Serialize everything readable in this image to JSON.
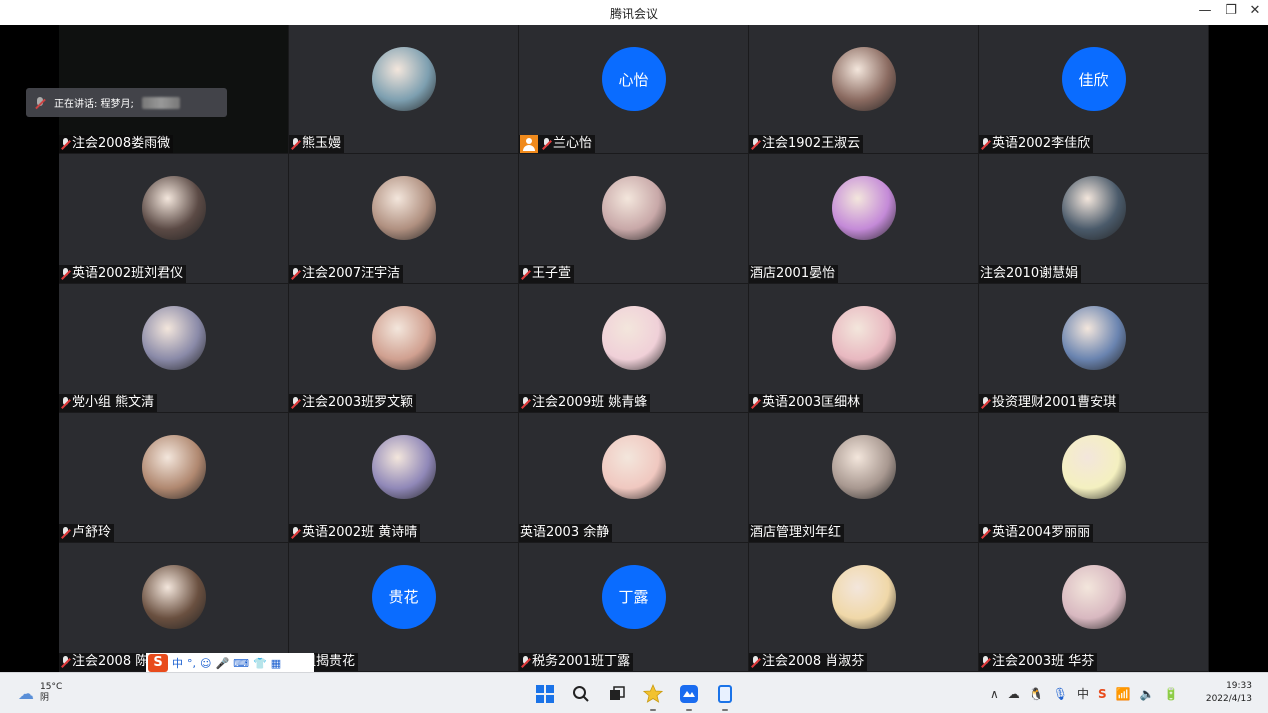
{
  "window": {
    "title": "腾讯会议",
    "controls": {
      "minimize": "—",
      "restore": "❐",
      "close": "✕"
    }
  },
  "speaking": {
    "label": "正在讲话: 程梦月;"
  },
  "participants": [
    {
      "name": "注会2008娄雨微",
      "muted": true,
      "video": true
    },
    {
      "name": "熊玉嫚",
      "muted": true,
      "avatar": "photo-avatar",
      "color": "#7d9fb0"
    },
    {
      "name": "兰心怡",
      "muted": true,
      "host": true,
      "avatar_text": "心怡"
    },
    {
      "name": "注会1902王淑云",
      "muted": true,
      "avatar": "photo-avatar",
      "color": "#8a6a60"
    },
    {
      "name": "英语2002李佳欣",
      "muted": true,
      "avatar_text": "佳欣"
    },
    {
      "name": "英语2002班刘君仪",
      "muted": true,
      "avatar": "photo-avatar",
      "color": "#5b4a45"
    },
    {
      "name": "注会2007汪宇洁",
      "muted": true,
      "avatar": "photo-avatar",
      "color": "#b09080"
    },
    {
      "name": "王子萱",
      "muted": true,
      "avatar": "photo-avatar",
      "color": "#c8a8a8"
    },
    {
      "name": "酒店2001晏怡",
      "muted": false,
      "avatar": "cartoon-avatar",
      "color": "#c48ad8"
    },
    {
      "name": "注会2010谢慧娟",
      "muted": false,
      "avatar": "photo-avatar",
      "color": "#4a5a6a"
    },
    {
      "name": "党小组 熊文清",
      "muted": true,
      "avatar": "photo-avatar",
      "color": "#8a8aa8"
    },
    {
      "name": "注会2003班罗文颖",
      "muted": true,
      "avatar": "photo-avatar",
      "color": "#d0a090"
    },
    {
      "name": "注会2009班 姚青蜂",
      "muted": true,
      "avatar": "cartoon-avatar",
      "color": "#f0d0d8"
    },
    {
      "name": "英语2003匡细林",
      "muted": true,
      "avatar": "cartoon-avatar",
      "color": "#e8b8c0"
    },
    {
      "name": "投资理财2001曹安琪",
      "muted": true,
      "avatar": "cartoon-avatar",
      "color": "#6a84b0"
    },
    {
      "name": "卢舒玲",
      "muted": true,
      "avatar": "photo-avatar",
      "color": "#b08870"
    },
    {
      "name": "英语2002班 黄诗晴",
      "muted": true,
      "avatar": "photo-avatar",
      "color": "#9088b8"
    },
    {
      "name": "英语2003 余静",
      "muted": false,
      "avatar": "cartoon-avatar",
      "color": "#f0c8c0"
    },
    {
      "name": "酒店管理刘年红",
      "muted": false,
      "avatar": "photo-avatar",
      "color": "#a89890"
    },
    {
      "name": "英语2004罗丽丽",
      "muted": true,
      "avatar": "cartoon-avatar",
      "color": "#f4f0c0"
    },
    {
      "name": "注会2008 陈",
      "muted": true,
      "avatar": "photo-avatar",
      "color": "#6a5040"
    },
    {
      "name": "小组揭贵花",
      "muted": false,
      "avatar_text": "贵花"
    },
    {
      "name": "税务2001班丁露",
      "muted": true,
      "avatar_text": "丁露"
    },
    {
      "name": "注会2008 肖淑芬",
      "muted": true,
      "avatar": "cartoon-avatar",
      "color": "#f0d8a8"
    },
    {
      "name": "注会2003班 华芬",
      "muted": true,
      "avatar": "cartoon-avatar",
      "color": "#d8b8c0"
    }
  ],
  "ime_toolbar": {
    "logo": "S",
    "mode": "中",
    "punct": "°,",
    "emoji": "☺",
    "voice": "🎤",
    "keyboard": "⌨",
    "skin": "👕",
    "grid": "▦"
  },
  "taskbar": {
    "weather_temp": "15°C",
    "weather_desc": "阴",
    "tray_lang": "中",
    "tray_chevron": "∧",
    "time": "19:33",
    "date": "2022/4/13"
  }
}
